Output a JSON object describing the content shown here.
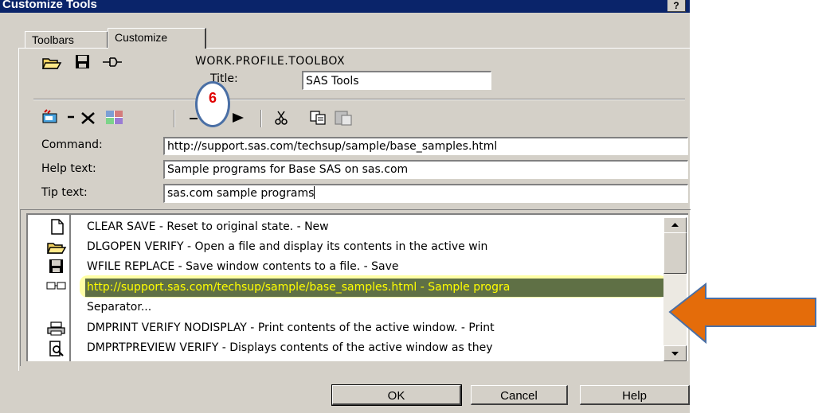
{
  "window": {
    "title": "Customize Tools",
    "help_glyph": "?"
  },
  "tabs": [
    {
      "label": "Toolbars"
    },
    {
      "label": "Customize"
    }
  ],
  "toolbox": {
    "path": "WORK.PROFILE.TOOLBOX",
    "title_label": "Title:",
    "title_value": "SAS Tools"
  },
  "callout": {
    "number": "6"
  },
  "fields": {
    "command_label": "Command:",
    "command_value": "http://support.sas.com/techsup/sample/base_samples.html",
    "help_label": "Help text:",
    "help_value": "Sample programs for Base SAS on sas.com",
    "tip_label": "Tip text:",
    "tip_value": "sas.com sample programs"
  },
  "tools": [
    {
      "icon": "new-page-icon",
      "text": "CLEAR SAVE - Reset to original state. - New"
    },
    {
      "icon": "open-folder-icon",
      "text": "DLGOPEN VERIFY - Open a file and display its contents in the active win"
    },
    {
      "icon": "save-disk-icon",
      "text": "WFILE REPLACE - Save window contents to a file. - Save"
    },
    {
      "icon": "link-icon",
      "text": "http://support.sas.com/techsup/sample/base_samples.html - Sample progra",
      "selected": true
    },
    {
      "icon": "",
      "text": "Separator..."
    },
    {
      "icon": "printer-icon",
      "text": "DMPRINT VERIFY NODISPLAY - Print contents of the active window. - Print"
    },
    {
      "icon": "print-preview-icon",
      "text": "DMPRTPREVIEW VERIFY - Displays contents of the active window as they"
    }
  ],
  "buttons": {
    "ok": "OK",
    "cancel": "Cancel",
    "help": "Help"
  },
  "colors": {
    "title_bar": "#0a246a",
    "dialog_bg": "#d4d0c8",
    "highlight": "#ffff00",
    "arrow": "#e46c0a",
    "callout_border": "#4a6fa5",
    "callout_text": "#e00000"
  }
}
